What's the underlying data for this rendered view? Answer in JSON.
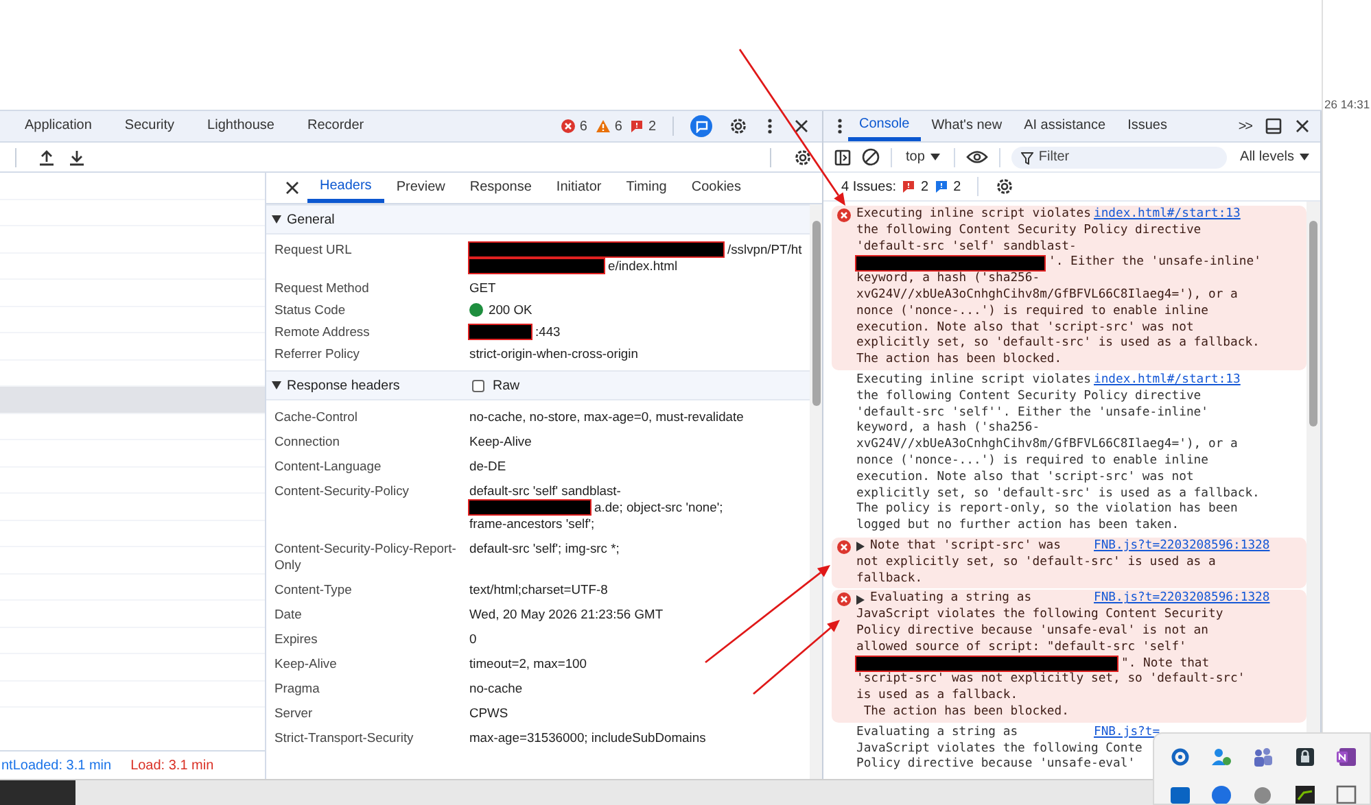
{
  "side_strip": {
    "clock": "26 14:31"
  },
  "main_tabs": [
    {
      "label": "Application",
      "selected": false
    },
    {
      "label": "Security",
      "selected": false
    },
    {
      "label": "Lighthouse",
      "selected": false
    },
    {
      "label": "Recorder",
      "selected": false
    }
  ],
  "counters": [
    {
      "kind": "error",
      "count": "6"
    },
    {
      "kind": "warning",
      "count": "6"
    },
    {
      "kind": "issue",
      "count": "2"
    }
  ],
  "network_rows": [
    {
      "selected": false
    },
    {
      "selected": false
    },
    {
      "selected": false
    },
    {
      "selected": false
    },
    {
      "selected": false
    },
    {
      "selected": false
    },
    {
      "selected": false
    },
    {
      "selected": false
    },
    {
      "selected": true
    },
    {
      "selected": false
    },
    {
      "selected": false
    },
    {
      "selected": false
    },
    {
      "selected": false
    },
    {
      "selected": false
    },
    {
      "selected": false
    },
    {
      "selected": false
    },
    {
      "selected": false
    },
    {
      "selected": false
    },
    {
      "selected": false
    },
    {
      "selected": false
    }
  ],
  "status_bar": [
    {
      "kind": "info",
      "text": "ntLoaded: 3.1 min"
    },
    {
      "kind": "error",
      "text": "Load: 3.1 min"
    }
  ],
  "detail_tabs": [
    {
      "label": "Headers",
      "selected": true
    },
    {
      "label": "Preview",
      "selected": false
    },
    {
      "label": "Response",
      "selected": false
    },
    {
      "label": "Initiator",
      "selected": false
    },
    {
      "label": "Timing",
      "selected": false
    },
    {
      "label": "Cookies",
      "selected": false
    }
  ],
  "sections": [
    {
      "title": "General",
      "expanded": true,
      "rows": [
        {
          "name": "Request URL",
          "lines": [
            {
              "redacted": true,
              "text": "/sslvpn/PT/ht"
            },
            {
              "redacted": true,
              "text": "e/index.html"
            }
          ]
        },
        {
          "name": "Request Method",
          "lines": [
            {
              "text": "GET"
            }
          ]
        },
        {
          "name": "Status Code",
          "color": "#1e8e3e",
          "lines": [
            {
              "text": "200 OK"
            }
          ]
        },
        {
          "name": "Remote Address",
          "lines": [
            {
              "redacted": true,
              "text": ":443"
            }
          ]
        },
        {
          "name": "Referrer Policy",
          "lines": [
            {
              "text": "strict-origin-when-cross-origin"
            }
          ]
        }
      ]
    },
    {
      "title": "Response headers",
      "expanded": true,
      "raw": {
        "label": "Raw",
        "checked": false
      },
      "rows": [
        {
          "name": "Cache-Control",
          "lines": [
            {
              "text": "no-cache, no-store, max-age=0, must-revalidate"
            }
          ]
        },
        {
          "name": "Connection",
          "lines": [
            {
              "text": "Keep-Alive"
            }
          ]
        },
        {
          "name": "Content-Language",
          "lines": [
            {
              "text": "de-DE"
            }
          ]
        },
        {
          "name": "Content-Security-Policy",
          "lines": [
            {
              "text": "default-src 'self' sandblast-"
            },
            {
              "redacted": true,
              "text": "a.de; object-src 'none';"
            },
            {
              "text": "frame-ancestors 'self';"
            }
          ]
        },
        {
          "name": "Content-Security-Policy-Report-Only",
          "lines": [
            {
              "text": "default-src 'self'; img-src *;"
            }
          ]
        },
        {
          "name": "Content-Type",
          "lines": [
            {
              "text": "text/html;charset=UTF-8"
            }
          ]
        },
        {
          "name": "Date",
          "lines": [
            {
              "text": "Wed, 20 May 2026 21:23:56 GMT"
            }
          ]
        },
        {
          "name": "Expires",
          "lines": [
            {
              "text": "0"
            }
          ]
        },
        {
          "name": "Keep-Alive",
          "lines": [
            {
              "text": "timeout=2, max=100"
            }
          ]
        },
        {
          "name": "Pragma",
          "lines": [
            {
              "text": "no-cache"
            }
          ]
        },
        {
          "name": "Server",
          "lines": [
            {
              "text": "CPWS"
            }
          ]
        },
        {
          "name": "Strict-Transport-Security",
          "lines": [
            {
              "text": "max-age=31536000; includeSubDomains"
            }
          ]
        }
      ]
    }
  ],
  "console": {
    "tabs": [
      {
        "label": "Console",
        "selected": true
      },
      {
        "label": "What's new",
        "selected": false
      },
      {
        "label": "AI assistance",
        "selected": false
      },
      {
        "label": "Issues",
        "selected": false
      }
    ],
    "more": ">>",
    "context": "top",
    "filter": {
      "placeholder": "Filter"
    },
    "levels": "All levels",
    "issues": {
      "label": "4 Issues:",
      "errors": "2",
      "infos": "2"
    },
    "messages": [
      {
        "kind": "error",
        "expandable": false,
        "source": "index.html#/start:13",
        "lines": [
          {
            "text": "Executing inline script violates"
          },
          {
            "text": "the following Content Security Policy directive"
          },
          {
            "text": "'default-src 'self' sandblast-"
          },
          {
            "redacted": true,
            "text": "'. Either the 'unsafe-inline'"
          },
          {
            "text": "keyword, a hash ('sha256-"
          },
          {
            "text": "xvG24V//xbUeA3oCnhghCihv8m/GfBFVL66C8Ilaeg4='), or a"
          },
          {
            "text": "nonce ('nonce-...') is required to enable inline"
          },
          {
            "text": "execution. Note also that 'script-src' was not"
          },
          {
            "text": "explicitly set, so 'default-src' is used as a fallback."
          },
          {
            "text": "The action has been blocked."
          }
        ]
      },
      {
        "kind": "info",
        "expandable": false,
        "source": "index.html#/start:13",
        "lines": [
          {
            "text": "Executing inline script violates"
          },
          {
            "text": "the following Content Security Policy directive"
          },
          {
            "text": "'default-src 'self''. Either the 'unsafe-inline'"
          },
          {
            "text": "keyword, a hash ('sha256-"
          },
          {
            "text": "xvG24V//xbUeA3oCnhghCihv8m/GfBFVL66C8Ilaeg4='), or a"
          },
          {
            "text": "nonce ('nonce-...') is required to enable inline"
          },
          {
            "text": "execution. Note also that 'script-src' was not"
          },
          {
            "text": "explicitly set, so 'default-src' is used as a fallback."
          },
          {
            "text": "The policy is report-only, so the violation has been"
          },
          {
            "text": "logged but no further action has been taken."
          }
        ]
      },
      {
        "kind": "error",
        "expandable": true,
        "source": "FNB.js?t=2203208596:1328",
        "lines": [
          {
            "text": "Note that 'script-src' was"
          },
          {
            "text": "not explicitly set, so 'default-src' is used as a"
          },
          {
            "text": "fallback."
          }
        ]
      },
      {
        "kind": "error",
        "expandable": true,
        "source": "FNB.js?t=2203208596:1328",
        "lines": [
          {
            "text": "Evaluating a string as"
          },
          {
            "text": "JavaScript violates the following Content Security"
          },
          {
            "text": "Policy directive because 'unsafe-eval' is not an"
          },
          {
            "text": "allowed source of script: \"default-src 'self'"
          },
          {
            "redacted": true,
            "text": "\". Note that"
          },
          {
            "text": "'script-src' was not explicitly set, so 'default-src'"
          },
          {
            "text": "is used as a fallback."
          },
          {
            "text": " The action has been blocked."
          }
        ]
      },
      {
        "kind": "info",
        "expandable": false,
        "source": "FNB.js?t=",
        "lines": [
          {
            "text": "Evaluating a string as"
          },
          {
            "text": "JavaScript violates the following Conte"
          },
          {
            "text": "Policy directive because 'unsafe-eval'"
          }
        ]
      }
    ]
  }
}
